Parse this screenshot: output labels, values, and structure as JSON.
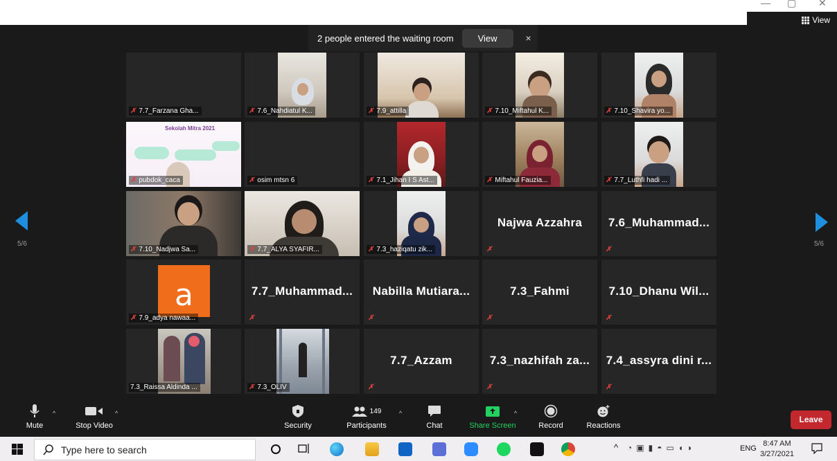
{
  "window": {
    "minimize": "—",
    "restore": "▢",
    "close": "✕",
    "view_label": "View"
  },
  "notification": {
    "message": "2 people entered the waiting room",
    "view_label": "View",
    "close": "×"
  },
  "page": {
    "left_indicator": "5/6",
    "right_indicator": "5/6"
  },
  "participants": [
    {
      "name": "7.7_Farzana Gha...",
      "video": false
    },
    {
      "name": "7.6_Nahdiatul K...",
      "video": true
    },
    {
      "name": "7.9_attilla",
      "video": true
    },
    {
      "name": "7.10_Miftahul K...",
      "video": true
    },
    {
      "name": "7.10_Shavira yo...",
      "video": true
    },
    {
      "name": "pubdok_caca",
      "video": true,
      "banner_title": "Sekolah Mitra 2021"
    },
    {
      "name": "osim mtsn 6",
      "video": false
    },
    {
      "name": "7.1_Jihan I S Ast...",
      "video": true
    },
    {
      "name": "Miftahul Fauzia...",
      "video": true
    },
    {
      "name": "7.7_Luthfi hadi ...",
      "video": true
    },
    {
      "name": "7.10_Nadjwa Sa...",
      "video": true
    },
    {
      "name": "7.7_ALYA SYAFIR...",
      "video": true
    },
    {
      "name": "7.3_haziqatu zik...",
      "video": true
    },
    {
      "name": "",
      "big_name": "Najwa Azzahra",
      "video": false
    },
    {
      "name": "",
      "big_name": "7.6_Muhammad...",
      "video": false
    },
    {
      "name": "7.9_adya nawaa...",
      "video": false,
      "avatar_letter": "a"
    },
    {
      "name": "",
      "big_name": "7.7_Muhammad...",
      "video": false
    },
    {
      "name": "",
      "big_name": "Nabilla Mutiara...",
      "video": false
    },
    {
      "name": "",
      "big_name": "7.3_Fahmi",
      "video": false
    },
    {
      "name": "",
      "big_name": "7.10_Dhanu Wil...",
      "video": false
    },
    {
      "name": "7.3_Raissa Aldinda ...",
      "video": true
    },
    {
      "name": "7.3_OLIV",
      "video": true
    },
    {
      "name": "",
      "big_name": "7.7_Azzam",
      "video": false
    },
    {
      "name": "",
      "big_name": "7.3_nazhifah za...",
      "video": false
    },
    {
      "name": "",
      "big_name": "7.4_assyra dini r...",
      "video": false
    }
  ],
  "toolbar": {
    "mute": "Mute",
    "stop_video": "Stop Video",
    "security": "Security",
    "participants": "Participants",
    "participants_count": "149",
    "chat": "Chat",
    "share_screen": "Share Screen",
    "record": "Record",
    "reactions": "Reactions",
    "leave": "Leave"
  },
  "taskbar": {
    "search_placeholder": "Type here to search",
    "language": "ENG",
    "time": "8:47 AM",
    "date": "3/27/2021"
  },
  "colors": {
    "accent_blue": "#1e8fde",
    "leave_red": "#c4282f",
    "share_green": "#23d160",
    "mic_red": "#e0403c"
  }
}
